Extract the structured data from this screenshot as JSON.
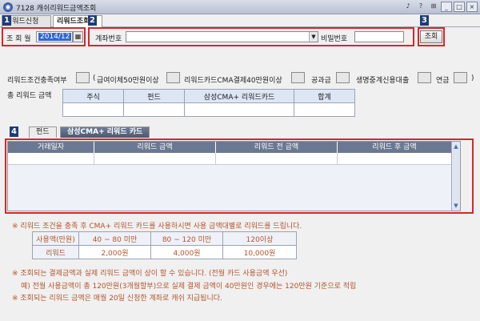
{
  "window": {
    "title": "7128 캐쉬리워드금액조회",
    "controls": [
      "♪",
      "?",
      "⊞",
      "_",
      "□",
      "×"
    ]
  },
  "tabs": [
    {
      "label": "리워드신청"
    },
    {
      "label": "리워드조회"
    }
  ],
  "badges": [
    "1",
    "2",
    "3",
    "4"
  ],
  "query": {
    "month_label": "조 회 월",
    "month_value": "2014/12",
    "account_label": "계좌번호",
    "account_value": "",
    "password_label": "비밀번호",
    "password_value": "",
    "search_button": "조회"
  },
  "conditions": {
    "label": "리워드조건충족여부",
    "open_paren": "(",
    "items": [
      "급여이체50만원이상",
      "리워드카드CMA결제40만원이상",
      "공과금",
      "생명중계신용대출",
      "연금"
    ],
    "close_paren": ")"
  },
  "summary": {
    "label": "총 리워드 금액",
    "headers": [
      "주식",
      "펀드",
      "삼성CMA+ 리워드카드",
      "합계"
    ],
    "values": [
      "",
      "",
      "",
      ""
    ]
  },
  "subtabs": [
    {
      "label": "펀드"
    },
    {
      "label": "삼성CMA+ 리워드 카드"
    }
  ],
  "grid": {
    "headers": [
      "거래일자",
      "리워드 금액",
      "리워드 전 금액",
      "리워드 후 금액"
    ],
    "scroll_up": "▲",
    "scroll_down": "▼"
  },
  "notes": {
    "note1": "※ 리워드 조건을 충족 후 CMA+ 리워드 카드를 사용하시면 사용 금액대별로 리워드를 드립니다.",
    "rates_header": [
      "사용액(만원)",
      "40 ~ 80 미만",
      "80 ~ 120 미만",
      "120이상"
    ],
    "rates_row": [
      "리워드",
      "2,000원",
      "4,000원",
      "10,000원"
    ],
    "note2": "※ 조회되는 결제금액과 실제 리워드 금액이 상이 할 수 있습니다. (전월 카드 사용금액 우선)",
    "note3": "예) 전월 사용금액이 총 120만원(3개월할부)으로 실제 결제 금액이 40만원인 경우에는 120만원 기준으로 적립",
    "note4": "※ 조회되는 리워드 금액은 매월 20일 신청한 계좌로 캐쉬 지급됩니다."
  }
}
